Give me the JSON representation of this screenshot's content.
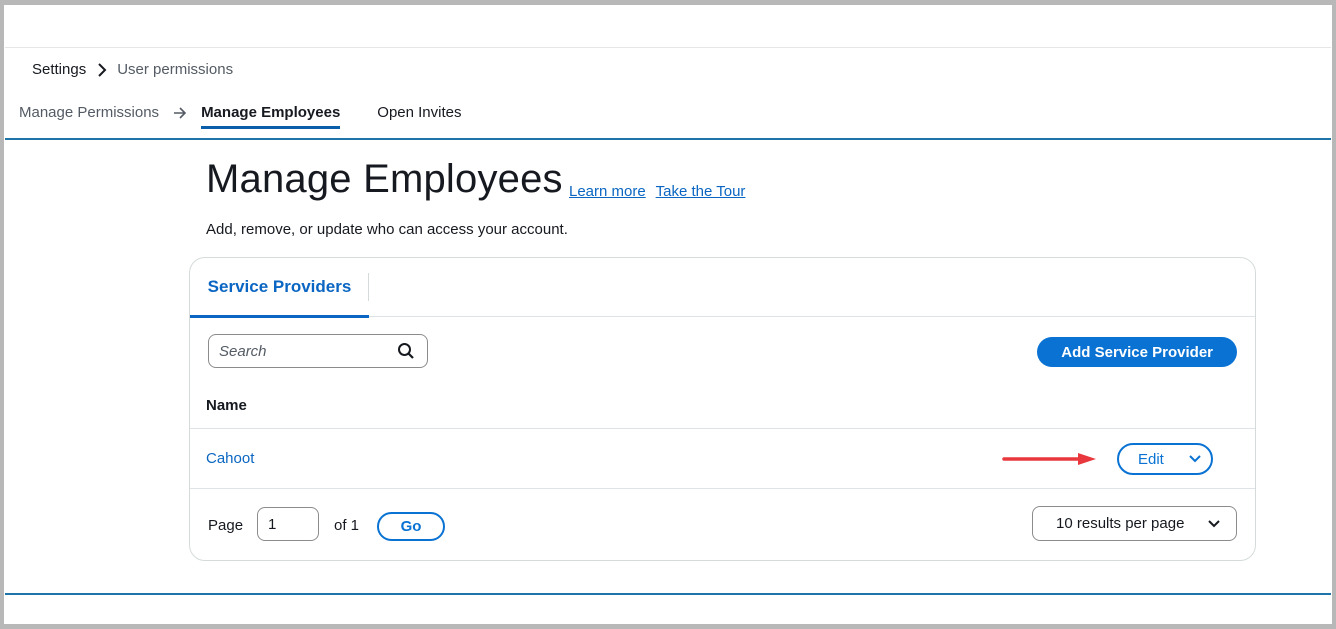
{
  "breadcrumb": {
    "root": "Settings",
    "current": "User permissions"
  },
  "steps": {
    "step1": "Manage Permissions",
    "step2": "Manage Employees",
    "step3": "Open Invites"
  },
  "header": {
    "title": "Manage Employees",
    "learn_more": "Learn more",
    "take_tour": "Take the Tour",
    "subtitle": "Add, remove, or update who can access your account."
  },
  "card": {
    "tab_label": "Service Providers",
    "search_placeholder": "Search",
    "add_button": "Add Service Provider",
    "column_name": "Name",
    "rows": [
      {
        "name": "Cahoot",
        "action": "Edit"
      }
    ],
    "pager": {
      "page_label": "Page",
      "page_value": "1",
      "of_label": "of 1",
      "go_label": "Go",
      "per_page": "10 results per page"
    }
  },
  "colors": {
    "accent": "#0972d3",
    "link": "#0a66c2",
    "rule": "#1f75aa",
    "annotation_arrow": "#e8383d"
  }
}
